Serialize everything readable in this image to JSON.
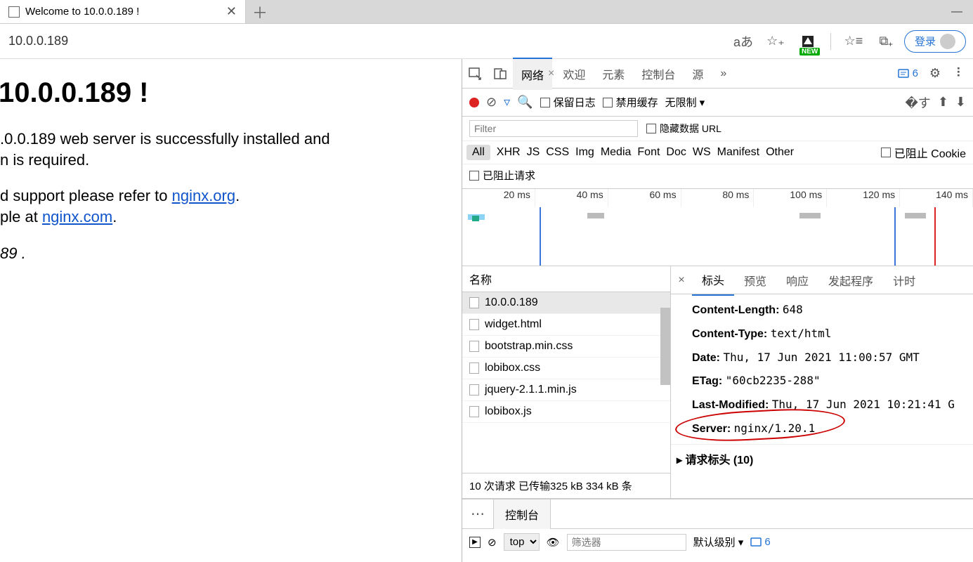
{
  "tab": {
    "title": "Welcome to 10.0.0.189 !"
  },
  "addr": {
    "url": "10.0.0.189",
    "login": "登录"
  },
  "page": {
    "heading": "10.0.0.189 !",
    "p1": ".0.0.189 web server is successfully installed and",
    "p1b": "n is required.",
    "p2a": "d support please refer to ",
    "p2link1": "nginx.org",
    "p2b": ".",
    "p3a": "ple at ",
    "p3link2": "nginx.com",
    "p3b": ".",
    "p4": "89 ."
  },
  "dev": {
    "tabs": [
      "网络",
      "欢迎",
      "元素",
      "控制台",
      "源"
    ],
    "active_tab": "网络",
    "issues_count": "6",
    "toolbar": {
      "preserve_log": "保留日志",
      "disable_cache": "禁用缓存",
      "throttle": "无限制"
    },
    "filter": {
      "placeholder": "Filter",
      "hide_data_url": "隐藏数据 URL",
      "types": [
        "All",
        "XHR",
        "JS",
        "CSS",
        "Img",
        "Media",
        "Font",
        "Doc",
        "WS",
        "Manifest",
        "Other"
      ],
      "blocked_cookie": "已阻止 Cookie",
      "blocked_req": "已阻止请求"
    },
    "waterfall_labels": [
      "20 ms",
      "40 ms",
      "60 ms",
      "80 ms",
      "100 ms",
      "120 ms",
      "140 ms"
    ],
    "requests": {
      "header": "名称",
      "items": [
        "10.0.0.189",
        "widget.html",
        "bootstrap.min.css",
        "lobibox.css",
        "jquery-2.1.1.min.js",
        "lobibox.js"
      ],
      "selected": 0
    },
    "summary": "10 次请求  已传输325 kB  334 kB 条",
    "detail_tabs": [
      "标头",
      "预览",
      "响应",
      "发起程序",
      "计时"
    ],
    "detail_active": "标头",
    "headers": [
      {
        "k": "Content-Length:",
        "v": "648"
      },
      {
        "k": "Content-Type:",
        "v": "text/html"
      },
      {
        "k": "Date:",
        "v": "Thu, 17 Jun 2021 11:00:57 GMT"
      },
      {
        "k": "ETag:",
        "v": "\"60cb2235-288\""
      },
      {
        "k": "Last-Modified:",
        "v": "Thu, 17 Jun 2021 10:21:41 G"
      },
      {
        "k": "Server:",
        "v": "nginx/1.20.1"
      }
    ],
    "req_header_toggle": "▸ 请求标头 (10)"
  },
  "drawer": {
    "tab": "控制台",
    "top": "top",
    "filter_placeholder": "筛选器",
    "level": "默认级别",
    "issues": "6"
  }
}
